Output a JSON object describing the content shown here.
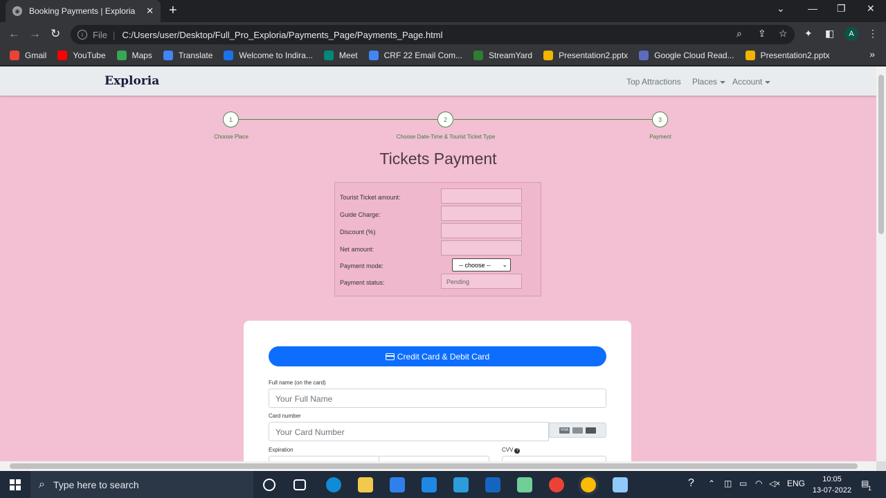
{
  "browser": {
    "tab_title": "Booking Payments | Exploria",
    "file_label": "File",
    "url": "C:/Users/user/Desktop/Full_Pro_Exploria/Payments_Page/Payments_Page.html",
    "profile_initial": "A",
    "bookmarks": [
      {
        "label": "Gmail",
        "color": "#ea4335"
      },
      {
        "label": "YouTube",
        "color": "#ff0000"
      },
      {
        "label": "Maps",
        "color": "#34a853"
      },
      {
        "label": "Translate",
        "color": "#4285f4"
      },
      {
        "label": "Welcome to Indira...",
        "color": "#1a73e8"
      },
      {
        "label": "Meet",
        "color": "#00897b"
      },
      {
        "label": "CRF 22 Email Com...",
        "color": "#4285f4"
      },
      {
        "label": "StreamYard",
        "color": "#2e7d32"
      },
      {
        "label": "Presentation2.pptx",
        "color": "#f4b400"
      },
      {
        "label": "Google Cloud Read...",
        "color": "#5c6bc0"
      },
      {
        "label": "Presentation2.pptx",
        "color": "#f4b400"
      }
    ]
  },
  "site": {
    "brand": "Exploria",
    "nav": {
      "top_attractions": "Top Attractions",
      "places": "Places",
      "account": "Account"
    },
    "steps": [
      {
        "number": "1",
        "label": "Choose Place"
      },
      {
        "number": "2",
        "label": "Choose Date-Time & Tourist Ticket Type"
      },
      {
        "number": "3",
        "label": "Payment"
      }
    ],
    "title": "Tickets Payment",
    "summary": {
      "ticket_amount_label": "Tourist Ticket amount:",
      "ticket_amount_value": "",
      "guide_charge_label": "Guide Charge:",
      "guide_charge_value": "",
      "discount_label": "Discount (%)",
      "discount_value": "",
      "net_amount_label": "Net amount:",
      "net_amount_value": "",
      "payment_mode_label": "Payment mode:",
      "payment_mode_selected": "-- choose --",
      "payment_status_label": "Payment status:",
      "payment_status_value": "Pending"
    },
    "card_form": {
      "tab_label": "Credit Card & Debit Card",
      "full_name_label": "Full name (on the card)",
      "full_name_placeholder": "Your Full Name",
      "card_number_label": "Card number",
      "card_number_placeholder": "Your Card Number",
      "card_brand_visa": "VISA",
      "expiration_label": "Expiration",
      "cvv_label": "CVV"
    }
  },
  "taskbar": {
    "search_placeholder": "Type here to search",
    "language": "ENG",
    "time": "10:05",
    "date": "13-07-2022",
    "notification_count": "1"
  }
}
